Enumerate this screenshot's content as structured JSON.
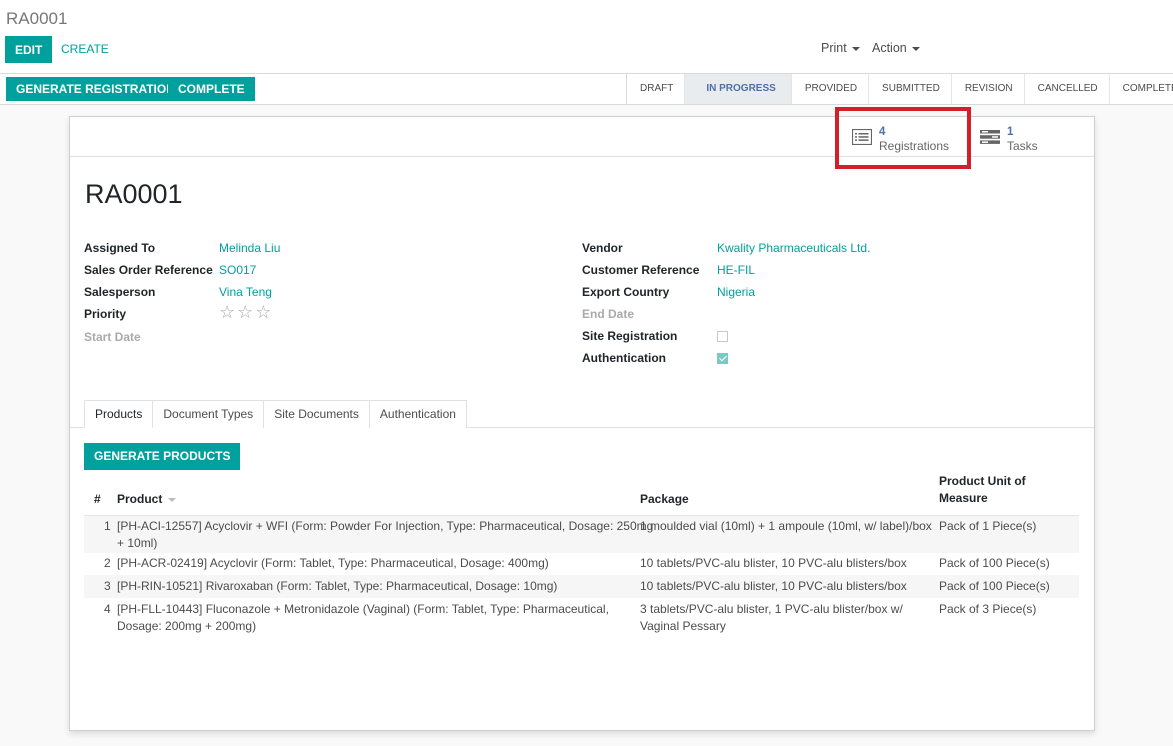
{
  "header": {
    "breadcrumb": "RA0001",
    "edit_label": "EDIT",
    "create_label": "CREATE",
    "print_label": "Print",
    "action_label": "Action"
  },
  "actions": {
    "generate_registration_label": "GENERATE REGISTRATION",
    "complete_label": "COMPLETE"
  },
  "statusbar": {
    "stages": [
      "DRAFT",
      "IN PROGRESS",
      "PROVIDED",
      "SUBMITTED",
      "REVISION",
      "CANCELLED",
      "COMPLETED"
    ],
    "active": "IN PROGRESS"
  },
  "smart_buttons": {
    "registrations": {
      "value": "4",
      "label": "Registrations",
      "icon": "list-icon"
    },
    "tasks": {
      "value": "1",
      "label": "Tasks",
      "icon": "tasks-icon"
    }
  },
  "record": {
    "title": "RA0001",
    "left": {
      "assigned_to_label": "Assigned To",
      "assigned_to": "Melinda Liu",
      "sales_order_label": "Sales Order Reference",
      "sales_order": "SO017",
      "salesperson_label": "Salesperson",
      "salesperson": "Vina Teng",
      "priority_label": "Priority",
      "priority_stars": 0,
      "start_date_label": "Start Date"
    },
    "right": {
      "vendor_label": "Vendor",
      "vendor": "Kwality Pharmaceuticals Ltd.",
      "customer_ref_label": "Customer Reference",
      "customer_ref": "HE-FIL",
      "export_country_label": "Export Country",
      "export_country": "Nigeria",
      "end_date_label": "End Date",
      "site_registration_label": "Site Registration",
      "site_registration": false,
      "authentication_label": "Authentication",
      "authentication": true
    }
  },
  "tabs": [
    "Products",
    "Document Types",
    "Site Documents",
    "Authentication"
  ],
  "products": {
    "generate_label": "GENERATE PRODUCTS",
    "columns": {
      "num": "#",
      "product": "Product",
      "package": "Package",
      "uom_line1": "Product Unit of",
      "uom_line2": "Measure"
    },
    "rows": [
      {
        "num": "1",
        "product_l1": "[PH-ACI-12557] Acyclovir + WFI (Form: Powder For Injection, Type: Pharmaceutical, Dosage: 250mg",
        "product_l2": "+ 10ml)",
        "package_l1": "1 moulded vial (10ml) + 1 ampoule (10ml, w/ label)/box",
        "package_l2": "",
        "uom": "Pack of 1 Piece(s)"
      },
      {
        "num": "2",
        "product_l1": "[PH-ACR-02419] Acyclovir (Form: Tablet, Type: Pharmaceutical, Dosage: 400mg)",
        "product_l2": "",
        "package_l1": "10 tablets/PVC-alu blister, 10 PVC-alu blisters/box",
        "package_l2": "",
        "uom": "Pack of 100 Piece(s)"
      },
      {
        "num": "3",
        "product_l1": "[PH-RIN-10521] Rivaroxaban (Form: Tablet, Type: Pharmaceutical, Dosage: 10mg)",
        "product_l2": "",
        "package_l1": "10 tablets/PVC-alu blister, 10 PVC-alu blisters/box",
        "package_l2": "",
        "uom": "Pack of 100 Piece(s)"
      },
      {
        "num": "4",
        "product_l1": "[PH-FLL-10443] Fluconazole + Metronidazole (Vaginal) (Form: Tablet, Type: Pharmaceutical,",
        "product_l2": "Dosage: 200mg + 200mg)",
        "package_l1": "3 tablets/PVC-alu blister, 1 PVC-alu blister/box w/",
        "package_l2": "Vaginal Pessary",
        "uom": "Pack of 3 Piece(s)"
      }
    ]
  },
  "colors": {
    "primary": "#00a09d",
    "highlight": "#d21f2b",
    "stage_active": "#4d70a8"
  }
}
